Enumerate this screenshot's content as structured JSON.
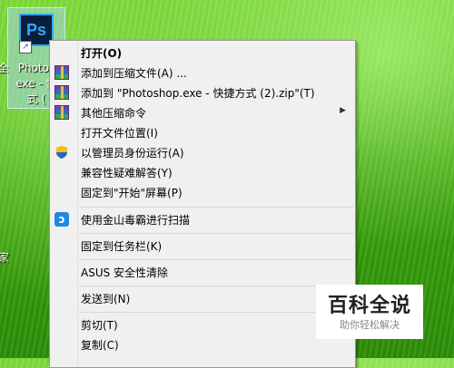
{
  "desktop": {
    "icon": {
      "glyph": "Ps",
      "label_lines": [
        "Photos",
        "exe - 快",
        "式 ("
      ]
    },
    "edge_fragments": [
      "全",
      "家"
    ]
  },
  "context_menu": {
    "items": [
      {
        "label": "打开(O)",
        "bold": true
      },
      {
        "label": "添加到压缩文件(A) ...",
        "icon": "winrar-icon"
      },
      {
        "label": "添加到 \"Photoshop.exe - 快捷方式 (2).zip\"(T)",
        "icon": "winrar-icon"
      },
      {
        "label": "其他压缩命令",
        "icon": "winrar-icon",
        "submenu": true
      },
      {
        "label": "打开文件位置(I)"
      },
      {
        "label": "以管理员身份运行(A)",
        "icon": "uac-shield-icon"
      },
      {
        "label": "兼容性疑难解答(Y)"
      },
      {
        "label": "固定到\"开始\"屏幕(P)"
      },
      {
        "label": "使用金山毒霸进行扫描",
        "icon": "jinshan-duba-icon"
      },
      {
        "label": "固定到任务栏(K)"
      },
      {
        "label": "ASUS 安全性清除"
      },
      {
        "label": "发送到(N)",
        "submenu": true
      },
      {
        "label": "剪切(T)"
      },
      {
        "label": "复制(C)"
      }
    ],
    "submenu_arrow": "▶"
  },
  "watermark": {
    "title": "百科全说",
    "subtitle": "助你轻松解决"
  },
  "colors": {
    "menu_background": "#f0f0f0",
    "grass_green": "#3fa90d",
    "selection_blue": "#31a8ff"
  }
}
